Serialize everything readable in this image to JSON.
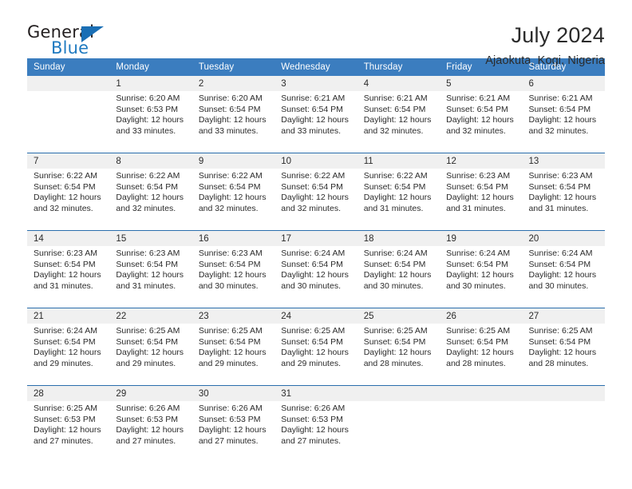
{
  "brand": {
    "word_one": "General",
    "word_two": "Blue",
    "logo_icon": "triangle-icon"
  },
  "header": {
    "title": "July 2024",
    "location": "Ajaokuta, Kogi, Nigeria"
  },
  "theme": {
    "header_blue": "#3b7dbf",
    "rule_blue": "#2a6ead",
    "daynum_band": "#f0f0f0",
    "brand_blue": "#1f7ac0",
    "text": "#2b2b2b"
  },
  "calendar": {
    "weekday_headers": [
      "Sunday",
      "Monday",
      "Tuesday",
      "Wednesday",
      "Thursday",
      "Friday",
      "Saturday"
    ],
    "weeks": [
      [
        {
          "day": "",
          "sunrise": "",
          "sunset": "",
          "daylight_1": "",
          "daylight_2": ""
        },
        {
          "day": "1",
          "sunrise": "Sunrise: 6:20 AM",
          "sunset": "Sunset: 6:53 PM",
          "daylight_1": "Daylight: 12 hours",
          "daylight_2": "and 33 minutes."
        },
        {
          "day": "2",
          "sunrise": "Sunrise: 6:20 AM",
          "sunset": "Sunset: 6:54 PM",
          "daylight_1": "Daylight: 12 hours",
          "daylight_2": "and 33 minutes."
        },
        {
          "day": "3",
          "sunrise": "Sunrise: 6:21 AM",
          "sunset": "Sunset: 6:54 PM",
          "daylight_1": "Daylight: 12 hours",
          "daylight_2": "and 33 minutes."
        },
        {
          "day": "4",
          "sunrise": "Sunrise: 6:21 AM",
          "sunset": "Sunset: 6:54 PM",
          "daylight_1": "Daylight: 12 hours",
          "daylight_2": "and 32 minutes."
        },
        {
          "day": "5",
          "sunrise": "Sunrise: 6:21 AM",
          "sunset": "Sunset: 6:54 PM",
          "daylight_1": "Daylight: 12 hours",
          "daylight_2": "and 32 minutes."
        },
        {
          "day": "6",
          "sunrise": "Sunrise: 6:21 AM",
          "sunset": "Sunset: 6:54 PM",
          "daylight_1": "Daylight: 12 hours",
          "daylight_2": "and 32 minutes."
        }
      ],
      [
        {
          "day": "7",
          "sunrise": "Sunrise: 6:22 AM",
          "sunset": "Sunset: 6:54 PM",
          "daylight_1": "Daylight: 12 hours",
          "daylight_2": "and 32 minutes."
        },
        {
          "day": "8",
          "sunrise": "Sunrise: 6:22 AM",
          "sunset": "Sunset: 6:54 PM",
          "daylight_1": "Daylight: 12 hours",
          "daylight_2": "and 32 minutes."
        },
        {
          "day": "9",
          "sunrise": "Sunrise: 6:22 AM",
          "sunset": "Sunset: 6:54 PM",
          "daylight_1": "Daylight: 12 hours",
          "daylight_2": "and 32 minutes."
        },
        {
          "day": "10",
          "sunrise": "Sunrise: 6:22 AM",
          "sunset": "Sunset: 6:54 PM",
          "daylight_1": "Daylight: 12 hours",
          "daylight_2": "and 32 minutes."
        },
        {
          "day": "11",
          "sunrise": "Sunrise: 6:22 AM",
          "sunset": "Sunset: 6:54 PM",
          "daylight_1": "Daylight: 12 hours",
          "daylight_2": "and 31 minutes."
        },
        {
          "day": "12",
          "sunrise": "Sunrise: 6:23 AM",
          "sunset": "Sunset: 6:54 PM",
          "daylight_1": "Daylight: 12 hours",
          "daylight_2": "and 31 minutes."
        },
        {
          "day": "13",
          "sunrise": "Sunrise: 6:23 AM",
          "sunset": "Sunset: 6:54 PM",
          "daylight_1": "Daylight: 12 hours",
          "daylight_2": "and 31 minutes."
        }
      ],
      [
        {
          "day": "14",
          "sunrise": "Sunrise: 6:23 AM",
          "sunset": "Sunset: 6:54 PM",
          "daylight_1": "Daylight: 12 hours",
          "daylight_2": "and 31 minutes."
        },
        {
          "day": "15",
          "sunrise": "Sunrise: 6:23 AM",
          "sunset": "Sunset: 6:54 PM",
          "daylight_1": "Daylight: 12 hours",
          "daylight_2": "and 31 minutes."
        },
        {
          "day": "16",
          "sunrise": "Sunrise: 6:23 AM",
          "sunset": "Sunset: 6:54 PM",
          "daylight_1": "Daylight: 12 hours",
          "daylight_2": "and 30 minutes."
        },
        {
          "day": "17",
          "sunrise": "Sunrise: 6:24 AM",
          "sunset": "Sunset: 6:54 PM",
          "daylight_1": "Daylight: 12 hours",
          "daylight_2": "and 30 minutes."
        },
        {
          "day": "18",
          "sunrise": "Sunrise: 6:24 AM",
          "sunset": "Sunset: 6:54 PM",
          "daylight_1": "Daylight: 12 hours",
          "daylight_2": "and 30 minutes."
        },
        {
          "day": "19",
          "sunrise": "Sunrise: 6:24 AM",
          "sunset": "Sunset: 6:54 PM",
          "daylight_1": "Daylight: 12 hours",
          "daylight_2": "and 30 minutes."
        },
        {
          "day": "20",
          "sunrise": "Sunrise: 6:24 AM",
          "sunset": "Sunset: 6:54 PM",
          "daylight_1": "Daylight: 12 hours",
          "daylight_2": "and 30 minutes."
        }
      ],
      [
        {
          "day": "21",
          "sunrise": "Sunrise: 6:24 AM",
          "sunset": "Sunset: 6:54 PM",
          "daylight_1": "Daylight: 12 hours",
          "daylight_2": "and 29 minutes."
        },
        {
          "day": "22",
          "sunrise": "Sunrise: 6:25 AM",
          "sunset": "Sunset: 6:54 PM",
          "daylight_1": "Daylight: 12 hours",
          "daylight_2": "and 29 minutes."
        },
        {
          "day": "23",
          "sunrise": "Sunrise: 6:25 AM",
          "sunset": "Sunset: 6:54 PM",
          "daylight_1": "Daylight: 12 hours",
          "daylight_2": "and 29 minutes."
        },
        {
          "day": "24",
          "sunrise": "Sunrise: 6:25 AM",
          "sunset": "Sunset: 6:54 PM",
          "daylight_1": "Daylight: 12 hours",
          "daylight_2": "and 29 minutes."
        },
        {
          "day": "25",
          "sunrise": "Sunrise: 6:25 AM",
          "sunset": "Sunset: 6:54 PM",
          "daylight_1": "Daylight: 12 hours",
          "daylight_2": "and 28 minutes."
        },
        {
          "day": "26",
          "sunrise": "Sunrise: 6:25 AM",
          "sunset": "Sunset: 6:54 PM",
          "daylight_1": "Daylight: 12 hours",
          "daylight_2": "and 28 minutes."
        },
        {
          "day": "27",
          "sunrise": "Sunrise: 6:25 AM",
          "sunset": "Sunset: 6:54 PM",
          "daylight_1": "Daylight: 12 hours",
          "daylight_2": "and 28 minutes."
        }
      ],
      [
        {
          "day": "28",
          "sunrise": "Sunrise: 6:25 AM",
          "sunset": "Sunset: 6:53 PM",
          "daylight_1": "Daylight: 12 hours",
          "daylight_2": "and 27 minutes."
        },
        {
          "day": "29",
          "sunrise": "Sunrise: 6:26 AM",
          "sunset": "Sunset: 6:53 PM",
          "daylight_1": "Daylight: 12 hours",
          "daylight_2": "and 27 minutes."
        },
        {
          "day": "30",
          "sunrise": "Sunrise: 6:26 AM",
          "sunset": "Sunset: 6:53 PM",
          "daylight_1": "Daylight: 12 hours",
          "daylight_2": "and 27 minutes."
        },
        {
          "day": "31",
          "sunrise": "Sunrise: 6:26 AM",
          "sunset": "Sunset: 6:53 PM",
          "daylight_1": "Daylight: 12 hours",
          "daylight_2": "and 27 minutes."
        },
        {
          "day": "",
          "sunrise": "",
          "sunset": "",
          "daylight_1": "",
          "daylight_2": ""
        },
        {
          "day": "",
          "sunrise": "",
          "sunset": "",
          "daylight_1": "",
          "daylight_2": ""
        },
        {
          "day": "",
          "sunrise": "",
          "sunset": "",
          "daylight_1": "",
          "daylight_2": ""
        }
      ]
    ]
  }
}
